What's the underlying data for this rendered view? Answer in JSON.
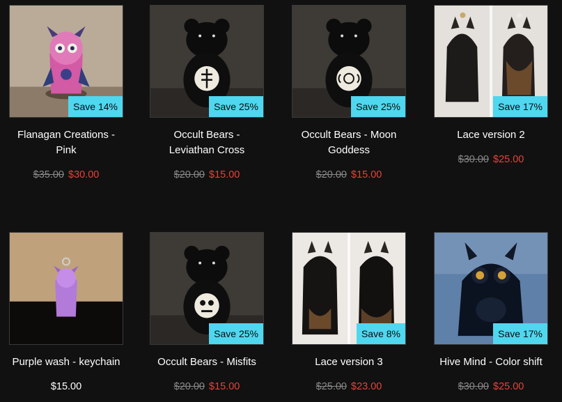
{
  "products": [
    {
      "title": "Flanagan Creations - Pink",
      "badge": "Save 14%",
      "compare_price": "$35.00",
      "price": "$30.00"
    },
    {
      "title": "Occult Bears - Leviathan Cross",
      "badge": "Save 25%",
      "compare_price": "$20.00",
      "price": "$15.00"
    },
    {
      "title": "Occult Bears - Moon Goddess",
      "badge": "Save 25%",
      "compare_price": "$20.00",
      "price": "$15.00"
    },
    {
      "title": "Lace version 2",
      "badge": "Save 17%",
      "compare_price": "$30.00",
      "price": "$25.00"
    },
    {
      "title": "Purple wash - keychain",
      "badge": "",
      "compare_price": "",
      "price": "$15.00"
    },
    {
      "title": "Occult Bears - Misfits",
      "badge": "Save 25%",
      "compare_price": "$20.00",
      "price": "$15.00"
    },
    {
      "title": "Lace version 3",
      "badge": "Save 8%",
      "compare_price": "$25.00",
      "price": "$23.00"
    },
    {
      "title": "Hive Mind - Color shift",
      "badge": "Save 17%",
      "compare_price": "$30.00",
      "price": "$25.00"
    }
  ],
  "colors": {
    "background": "#111111",
    "badge": "#4fd7ef",
    "sale_price": "#e8413a",
    "compare_price": "#8a8a8a"
  }
}
